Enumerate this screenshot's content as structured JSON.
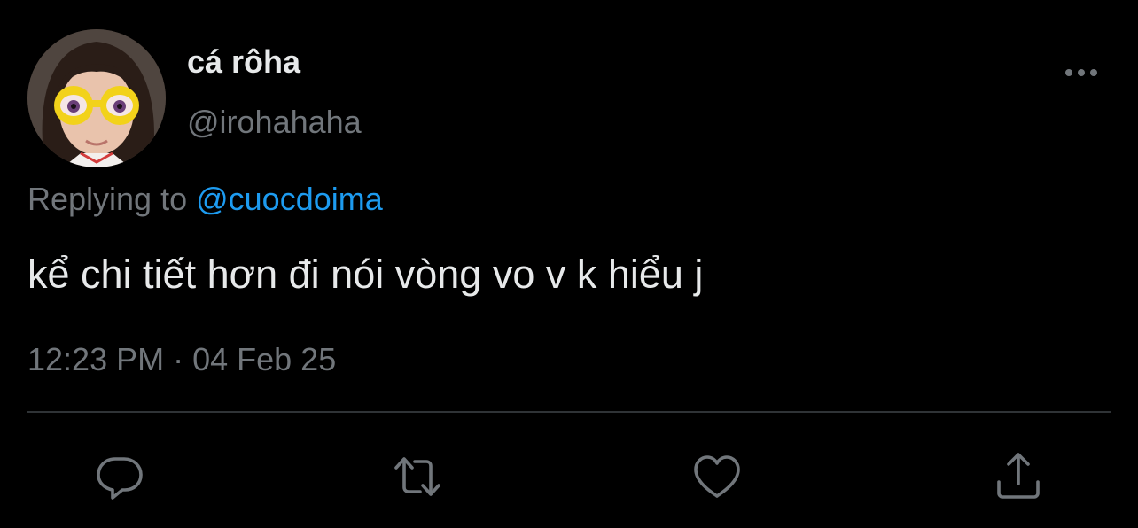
{
  "tweet": {
    "display_name": "cá rôha",
    "handle": "@irohahaha",
    "replying_prefix": "Replying to ",
    "replying_to": "@cuocdoima",
    "text": "kể chi tiết hơn đi nói vòng vo v k hiểu j",
    "time": "12:23 PM",
    "separator": " · ",
    "date": "04 Feb 25"
  },
  "actions": {
    "more_icon": "more-horizontal-icon",
    "reply_icon": "reply-icon",
    "retweet_icon": "retweet-icon",
    "like_icon": "heart-icon",
    "share_icon": "share-icon"
  },
  "colors": {
    "background": "#000000",
    "primary_text": "#e7e9ea",
    "secondary_text": "#71767b",
    "link": "#1d9bf0",
    "divider": "#2f3336"
  }
}
